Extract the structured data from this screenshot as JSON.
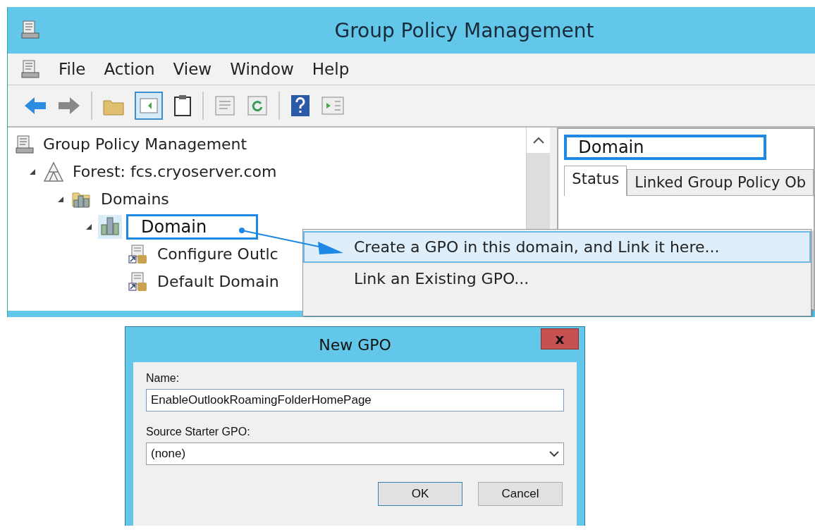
{
  "window": {
    "title": "Group Policy Management"
  },
  "menu_bar": [
    "File",
    "Action",
    "View",
    "Window",
    "Help"
  ],
  "tree": [
    {
      "label": "Group Policy Management",
      "kind": "console",
      "selected": false,
      "children": [
        {
          "label": "Forest: fcs.cryoserver.com",
          "kind": "forest",
          "expanded": true,
          "selected": false,
          "children": [
            {
              "label": "Domains",
              "kind": "domains",
              "expanded": true,
              "selected": false,
              "children": [
                {
                  "label": "Domain",
                  "kind": "domain",
                  "expanded": true,
                  "selected": true,
                  "children": [
                    {
                      "label": "Configure Outlc",
                      "kind": "gpo-link",
                      "selected": false
                    },
                    {
                      "label": "Default Domain",
                      "kind": "gpo-link",
                      "selected": false
                    }
                  ]
                }
              ]
            }
          ]
        }
      ]
    }
  ],
  "context_menu": [
    {
      "label": "Create a GPO in this domain, and Link it here...",
      "selected": true
    },
    {
      "label": "Link an Existing GPO...",
      "selected": false
    }
  ],
  "details": {
    "heading": "Domain",
    "tabs": [
      {
        "label": "Status",
        "selected": true
      },
      {
        "label": "Linked Group Policy Ob",
        "selected": false
      }
    ]
  },
  "dialog": {
    "title": "New GPO",
    "close": "x",
    "name_label": "Name:",
    "name_value": "EnableOutlookRoamingFolderHomePage",
    "source_label": "Source Starter GPO:",
    "source_value": "(none)",
    "buttons": [
      {
        "label": "OK",
        "default": true
      },
      {
        "label": "Cancel",
        "default": false
      }
    ]
  }
}
